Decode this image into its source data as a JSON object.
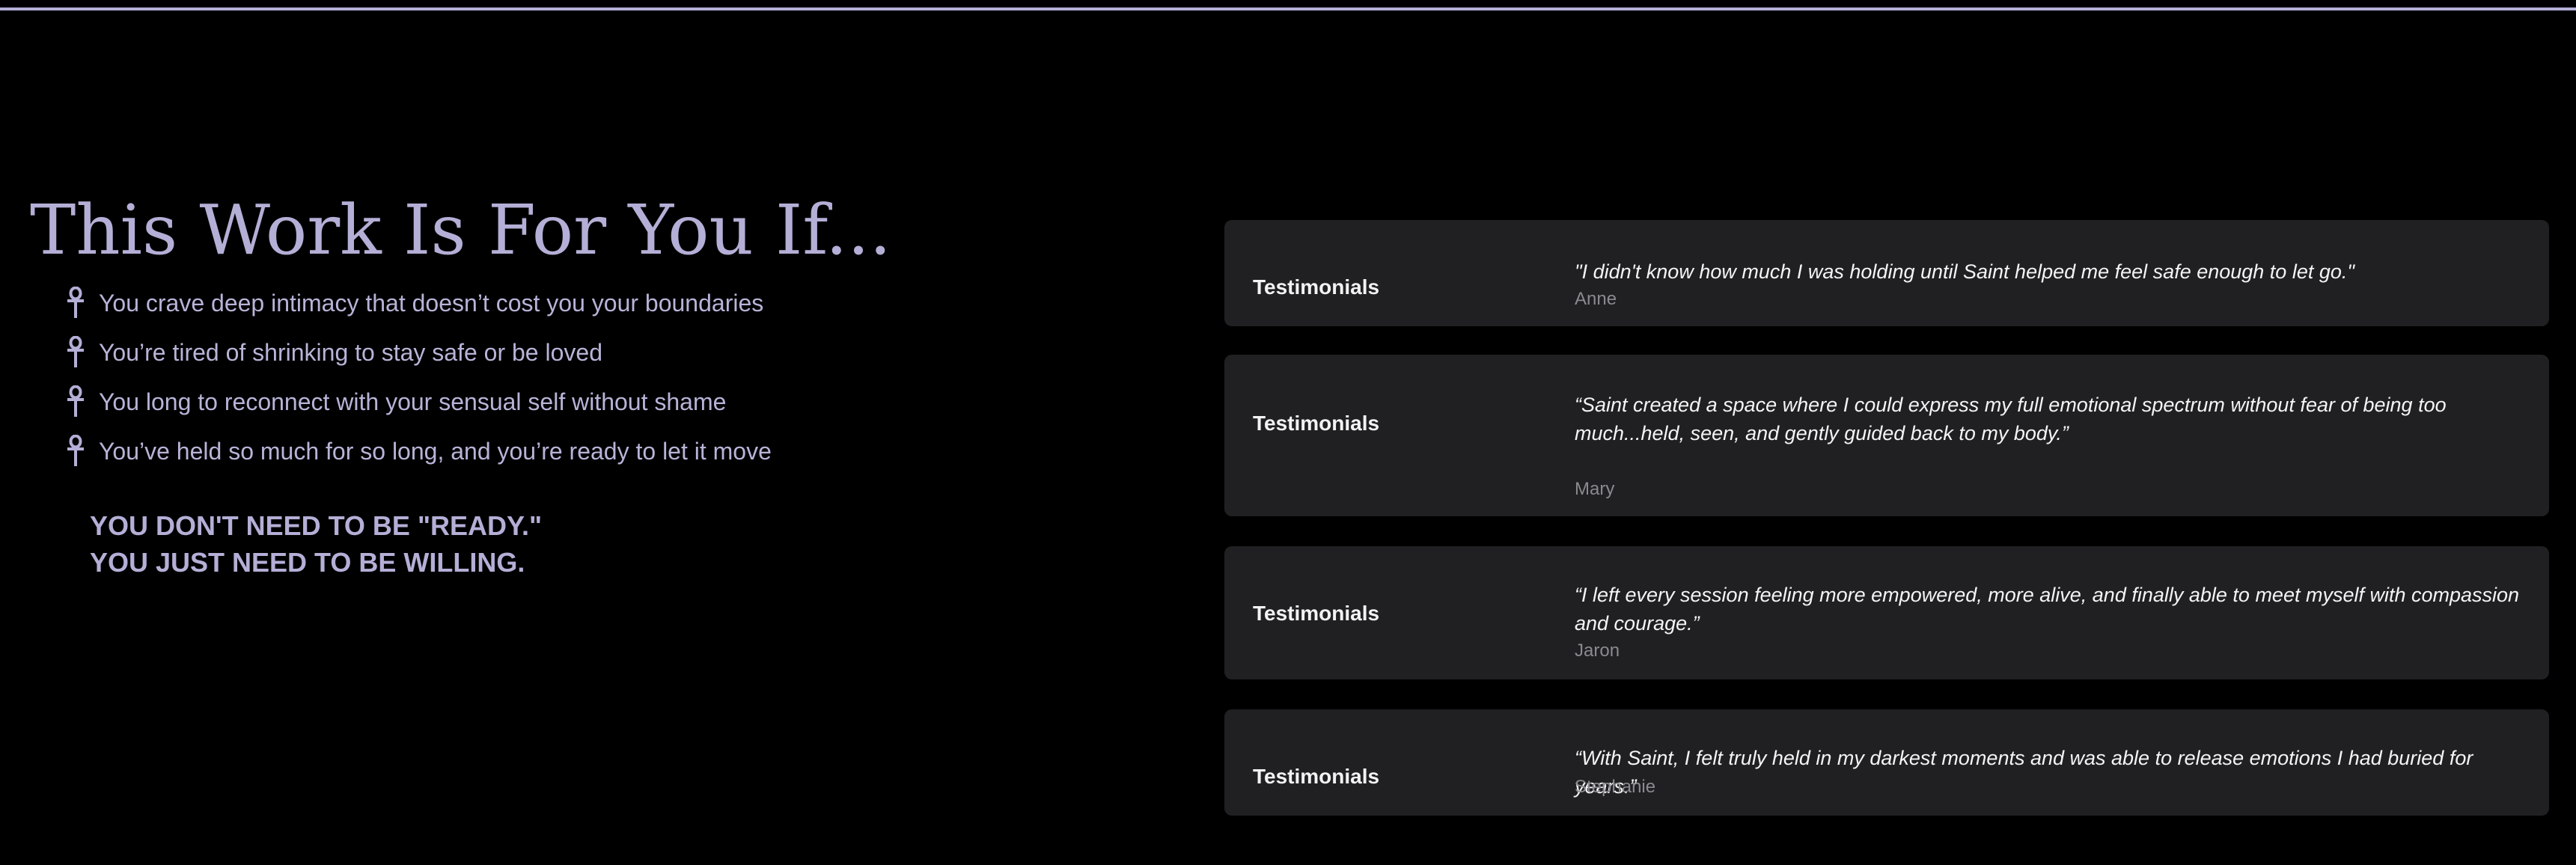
{
  "colors": {
    "background": "#000000",
    "accent": "#b3afd6",
    "card_background": "#202023",
    "author_text": "#8a8a8f"
  },
  "heading": {
    "title": "This Work Is For You If...",
    "bullet_icon": "ankh-icon",
    "bullets": [
      "You crave deep intimacy that doesn’t cost you your boundaries",
      "You’re tired of shrinking to stay safe or be loved",
      "You long to reconnect with your sensual self without shame",
      "You’ve held so much for so long, and you’re ready to let it move"
    ],
    "cta_lines": [
      "YOU DON'T NEED TO BE \"READY.\"",
      "YOU JUST NEED TO BE WILLING."
    ]
  },
  "testimonials": [
    {
      "label": "Testimonials",
      "quote": "\"I didn't know how much I was holding until Saint helped me feel safe enough to let go.\"",
      "author": "Anne"
    },
    {
      "label": "Testimonials",
      "quote": "“Saint created a space where I could express my full emotional spectrum without fear of being too much...held, seen, and gently guided back to my body.”",
      "author": "Mary"
    },
    {
      "label": "Testimonials",
      "quote": "“I left every session feeling more empowered, more alive, and finally able to meet myself with compassion and courage.”",
      "author": "Jaron"
    },
    {
      "label": "Testimonials",
      "quote": "“With Saint, I felt truly held in my darkest moments and was able to release emotions I had buried for years.”",
      "author": "Stephanie"
    }
  ]
}
